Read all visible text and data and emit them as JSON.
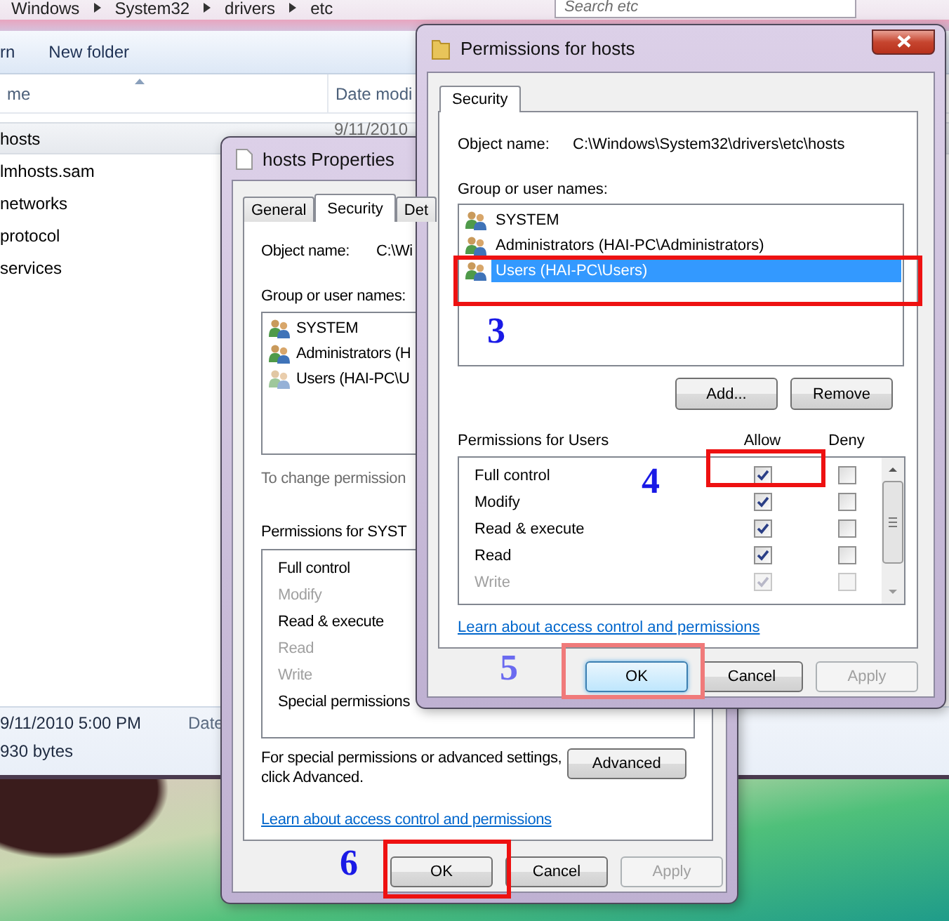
{
  "explorer": {
    "breadcrumb": [
      "Windows",
      "System32",
      "drivers",
      "etc"
    ],
    "search": {
      "placeholder": "Search etc"
    },
    "toolbar": [
      "rn",
      "New folder"
    ],
    "columns": [
      "me",
      "Date modi"
    ],
    "files": [
      {
        "name": "hosts",
        "date": "9/11/2010",
        "selected": true
      },
      {
        "name": "lmhosts.sam",
        "selected": false
      },
      {
        "name": "networks",
        "selected": false
      },
      {
        "name": "protocol",
        "selected": false
      },
      {
        "name": "services",
        "selected": false
      }
    ],
    "details": {
      "modified": "9/11/2010 5:00 PM",
      "label": "Date",
      "size": "930 bytes"
    }
  },
  "properties": {
    "title": "hosts Properties",
    "tabs": [
      {
        "label": "General",
        "selected": false
      },
      {
        "label": "Security",
        "selected": true
      },
      {
        "label": "Det",
        "selected": false
      }
    ],
    "object_label": "Object name:",
    "object_value": "C:\\Wi",
    "group_label": "Group or user names:",
    "groups": [
      {
        "name": "SYSTEM",
        "selected": false
      },
      {
        "name": "Administrators (H",
        "selected": false
      },
      {
        "name": "Users (HAI-PC\\U",
        "selected": false
      }
    ],
    "change_note": "To change permission",
    "permissions_label": "Permissions for SYST",
    "permissions": [
      {
        "name": "Full control",
        "disabled": false
      },
      {
        "name": "Modify",
        "disabled": true
      },
      {
        "name": "Read & execute",
        "disabled": false
      },
      {
        "name": "Read",
        "disabled": true
      },
      {
        "name": "Write",
        "disabled": true
      },
      {
        "name": "Special permissions",
        "disabled": false
      }
    ],
    "advanced_note": "For special permissions or advanced settings, click Advanced.",
    "advanced_button": "Advanced",
    "link": "Learn about access control and permissions",
    "buttons": [
      {
        "label": "OK",
        "disabled": false
      },
      {
        "label": "Cancel",
        "disabled": false
      },
      {
        "label": "Apply",
        "disabled": true
      }
    ]
  },
  "permissions": {
    "title": "Permissions for hosts",
    "tabs": [
      {
        "label": "Security",
        "selected": true
      }
    ],
    "object_label": "Object name:",
    "object_value": "C:\\Windows\\System32\\drivers\\etc\\hosts",
    "group_label": "Group or user names:",
    "groups": [
      {
        "name": "SYSTEM",
        "selected": false
      },
      {
        "name": "Administrators (HAI-PC\\Administrators)",
        "selected": false
      },
      {
        "name": "Users (HAI-PC\\Users)",
        "selected": true
      }
    ],
    "group_buttons": [
      "Add...",
      "Remove"
    ],
    "permissions_label": "Permissions for Users",
    "allow_label": "Allow",
    "deny_label": "Deny",
    "permissions": [
      {
        "name": "Full control",
        "allow": true,
        "deny": false,
        "disabled": false
      },
      {
        "name": "Modify",
        "allow": true,
        "deny": false,
        "disabled": false
      },
      {
        "name": "Read & execute",
        "allow": true,
        "deny": false,
        "disabled": false
      },
      {
        "name": "Read",
        "allow": true,
        "deny": false,
        "disabled": false
      },
      {
        "name": "Write",
        "allow": true,
        "deny": false,
        "disabled": true
      }
    ],
    "link": "Learn about access control and permissions",
    "buttons": [
      {
        "label": "OK",
        "disabled": false,
        "default": true
      },
      {
        "label": "Cancel",
        "disabled": false,
        "default": false
      },
      {
        "label": "Apply",
        "disabled": true,
        "default": false
      }
    ]
  },
  "annotations": [
    {
      "number": "3"
    },
    {
      "number": "4"
    },
    {
      "number": "5"
    },
    {
      "number": "6"
    }
  ]
}
